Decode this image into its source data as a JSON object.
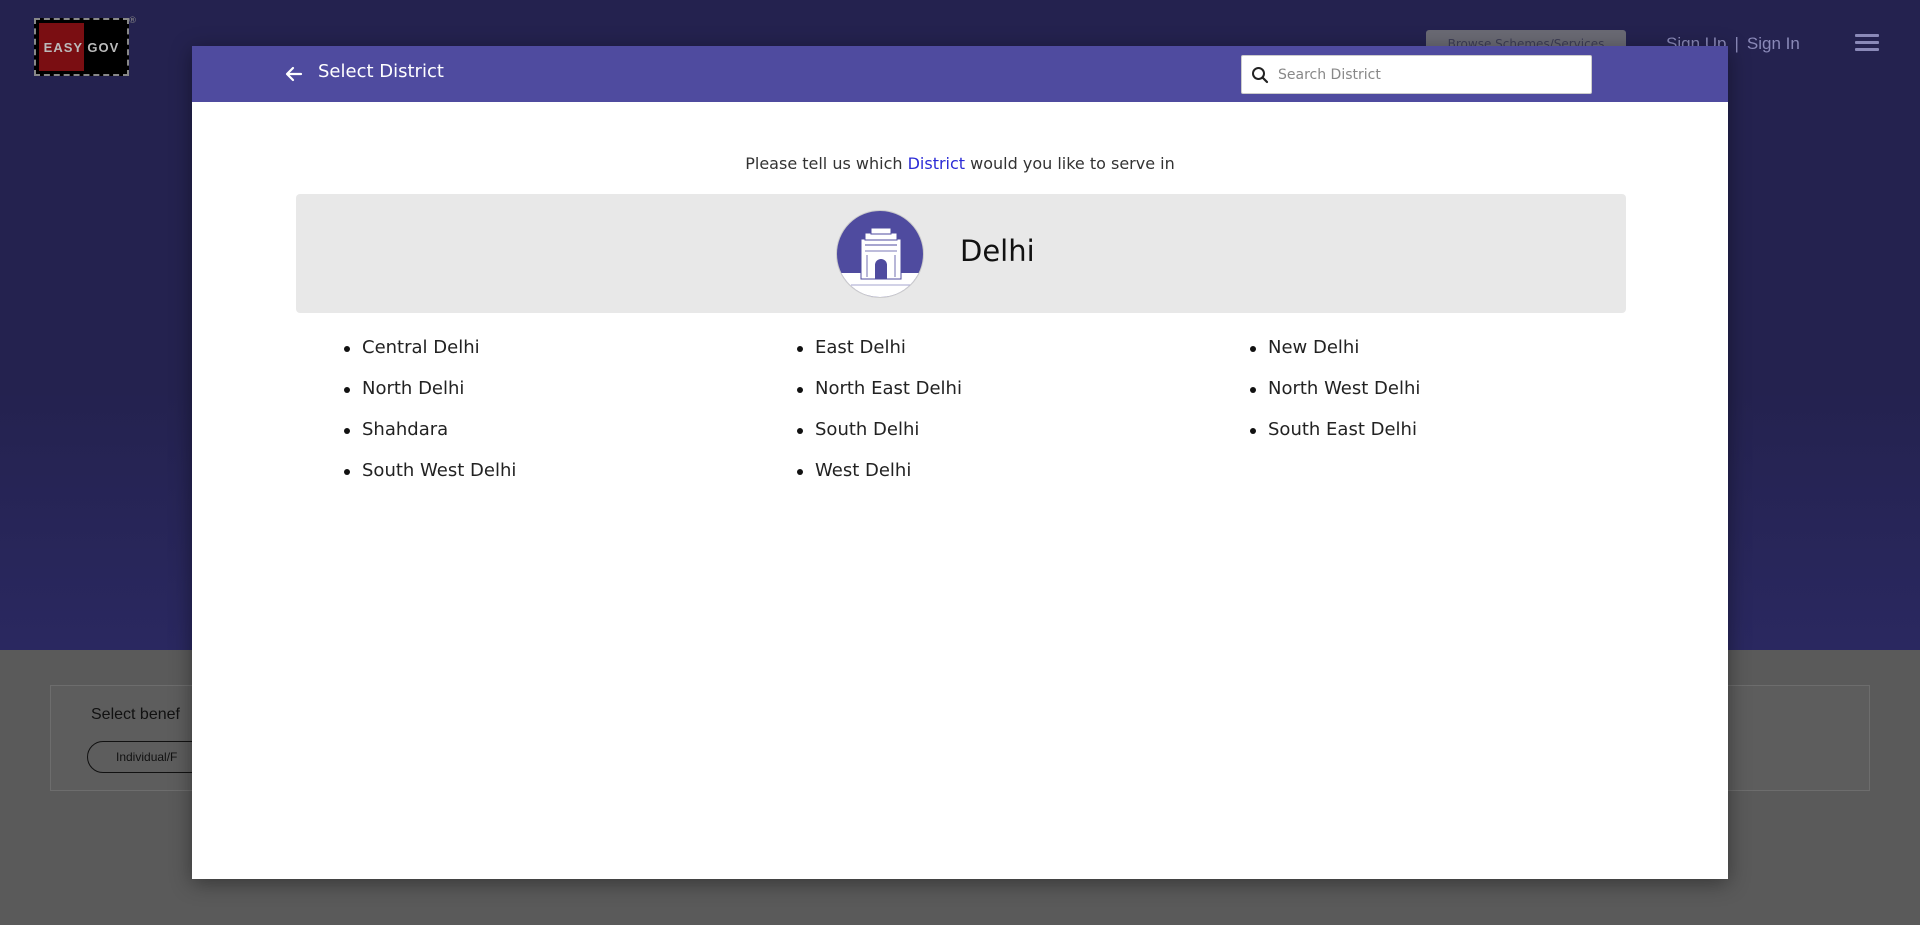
{
  "background": {
    "logo_text": "EASY GOV",
    "logo_reg": "®",
    "browse_label": "Browse Schemes/Services",
    "signup_label": "Sign Up",
    "separator": "|",
    "signin_label": "Sign In",
    "beneficiary_label": "Select benef",
    "beneficiary_pill": "Individual/F"
  },
  "modal": {
    "title": "Select District",
    "search_placeholder": "Search District",
    "prompt_before": "Please tell us which ",
    "prompt_highlight": "District",
    "prompt_after": " would you like to serve in",
    "state_name": "Delhi",
    "districts": [
      "Central Delhi",
      "East Delhi",
      "New Delhi",
      "North Delhi",
      "North East Delhi",
      "North West Delhi",
      "Shahdara",
      "South Delhi",
      "South East Delhi",
      "South West Delhi",
      "West Delhi"
    ]
  },
  "colors": {
    "header_purple": "#4f4b9f",
    "highlight_blue": "#2b2bd6",
    "banner_gray": "#e8e8e8"
  },
  "icons": {
    "back": "arrow-left-icon",
    "search": "search-icon",
    "state_emblem": "india-gate-icon",
    "menu": "hamburger-menu-icon"
  }
}
